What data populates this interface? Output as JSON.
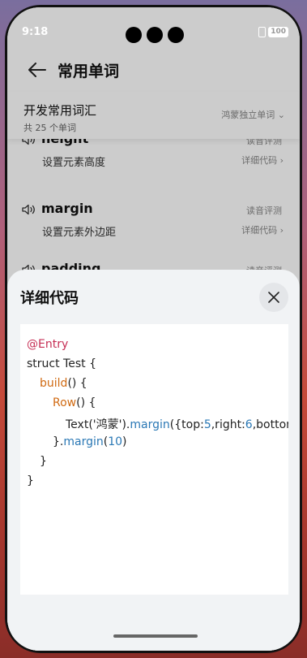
{
  "status": {
    "time": "9:18",
    "battery": "100"
  },
  "header": {
    "title": "常用单词"
  },
  "section": {
    "title": "开发常用词汇",
    "count": "共 25 个单词",
    "category": "鸿蒙独立单词"
  },
  "words": [
    {
      "name": "height",
      "desc": "设置元素高度",
      "action1": "读音评测",
      "action2": "详细代码"
    },
    {
      "name": "margin",
      "desc": "设置元素外边距",
      "action1": "读音评测",
      "action2": "详细代码"
    },
    {
      "name": "padding",
      "action1": "读音评测"
    }
  ],
  "sheet": {
    "title": "详细代码",
    "code": {
      "l1": "@Entry",
      "l2": "struct Test {",
      "l3a": "build",
      "l3b": "() {",
      "l4a": "Row",
      "l4b": "() {",
      "l5a": "Text('鸿蒙').",
      "l5b": "margin",
      "l5c": "({top:",
      "l5d": "5",
      "l5e": ",right:",
      "l5f": "6",
      "l5g": ",bottom:",
      "l6a": "}.",
      "l6b": "margin",
      "l6c": "(",
      "l6d": "10",
      "l6e": ")",
      "l7": "}",
      "l8": "}"
    }
  },
  "colors": {
    "keyword": "#c62e54",
    "component": "#d06a12",
    "method": "#2a78b5"
  }
}
